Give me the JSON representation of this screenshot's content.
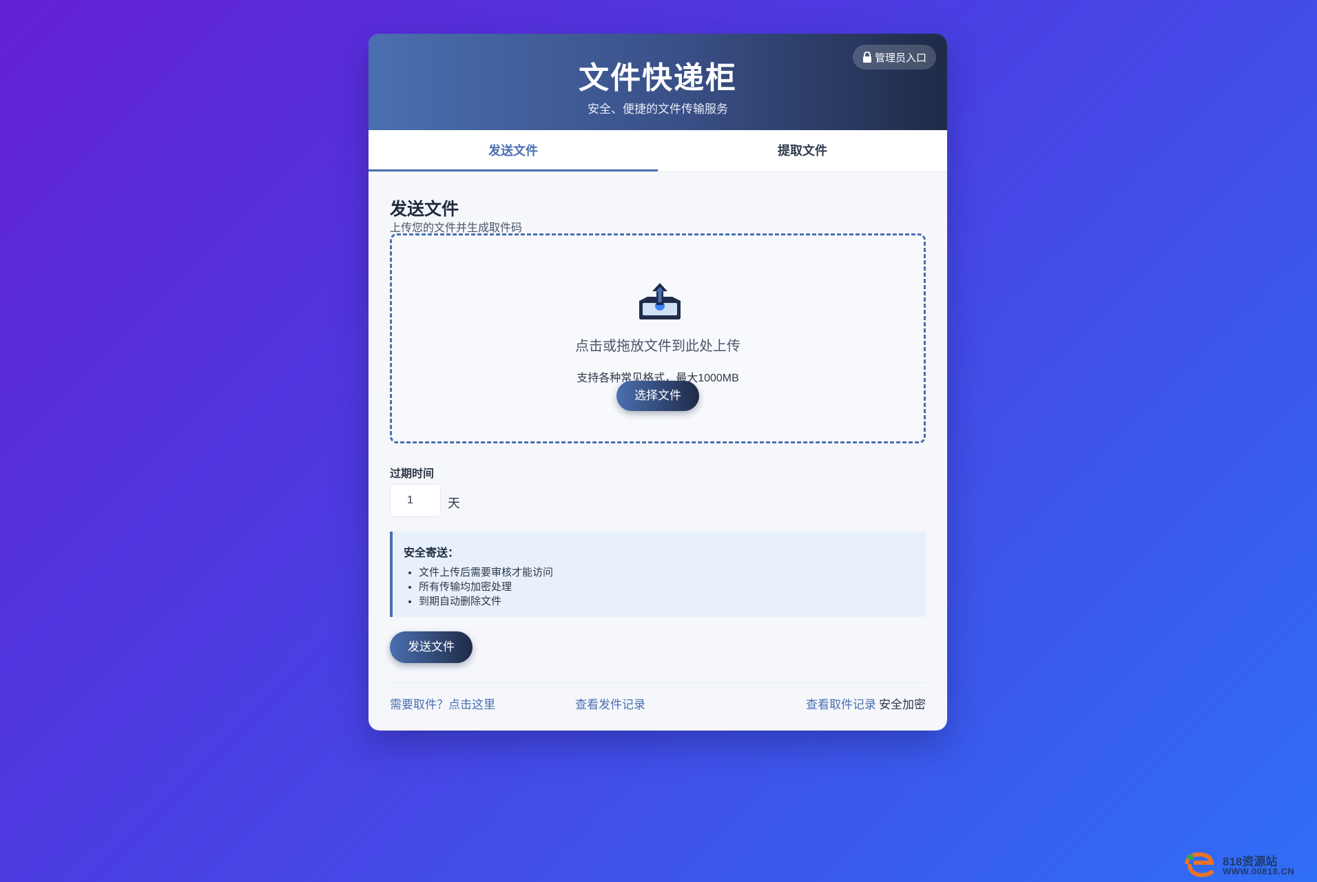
{
  "header": {
    "title": "文件快递柜",
    "subtitle": "安全、便捷的文件传输服务",
    "admin_label": "管理员入口"
  },
  "tabs": [
    {
      "label": "发送文件",
      "active": true
    },
    {
      "label": "提取文件",
      "active": false
    }
  ],
  "send": {
    "title": "发送文件",
    "subtitle": "上传您的文件并生成取件码",
    "dropzone": {
      "main_text": "点击或拖放文件到此处上传",
      "hint": "支持各种常见格式，最大1000MB",
      "button": "选择文件"
    },
    "expire": {
      "label": "过期时间",
      "value": "1",
      "unit": "天"
    },
    "notice": {
      "title": "安全寄送：",
      "items": [
        "文件上传后需要审核才能访问",
        "所有传输均加密处理",
        "到期自动删除文件"
      ]
    },
    "submit": "发送文件"
  },
  "footer": {
    "need_pickup": "需要取件？点击这里",
    "send_records": "查看发件记录",
    "pickup_records": "查看取件记录",
    "secure": "安全加密"
  },
  "watermark": {
    "name": "818资源站",
    "url": "WWW.00818.CN"
  },
  "colors": {
    "accent": "#4a6fb0",
    "header_dark": "#1f2b48",
    "bg_start": "#6320d4",
    "bg_end": "#2f6ef5"
  },
  "icons": [
    "lock-icon",
    "upload-tray-icon",
    "site-logo-icon"
  ]
}
